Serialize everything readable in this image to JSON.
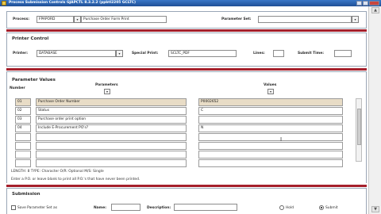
{
  "window": {
    "title": "Process Submission Controls GJAPCTL 8.3.2.2 (ppbtl2205 GCLTC)"
  },
  "header": {
    "process_label": "Process:",
    "process_code": "FPAPORD",
    "process_name": "Purchase Order Form Print",
    "parameter_set_label": "Parameter Set:",
    "parameter_set_value": ""
  },
  "printer_control": {
    "title": "Printer Control",
    "printer_label": "Printer:",
    "printer_value": "DATABASE",
    "special_print_label": "Special Print:",
    "special_print_value": "SCLTC_PDF",
    "lines_label": "Lines:",
    "lines_value": "",
    "submit_time_label": "Submit Time:",
    "submit_time_value": ""
  },
  "parameter_values": {
    "title": "Parameter Values",
    "col_number": "Number",
    "col_parameters": "Parameters",
    "col_values": "Values",
    "rows": [
      {
        "number": "01",
        "parameter": "Purchase Order Number",
        "value": "P0002652"
      },
      {
        "number": "02",
        "parameter": "Status",
        "value": "C"
      },
      {
        "number": "03",
        "parameter": "Purchase order print option",
        "value": ""
      },
      {
        "number": "04",
        "parameter": "Include E-Procurement PO's?",
        "value": "N"
      },
      {
        "number": "",
        "parameter": "",
        "value": ""
      },
      {
        "number": "",
        "parameter": "",
        "value": ""
      },
      {
        "number": "",
        "parameter": "",
        "value": ""
      },
      {
        "number": "",
        "parameter": "",
        "value": ""
      }
    ],
    "length_info": "LENGTH: 8 TYPE: Character O/R: Optional M/S: Single",
    "help_text": "Enter a P.O. or leave blank to print all P.O.'s that have never been printed."
  },
  "submission": {
    "title": "Submission",
    "save_param_label": "Save Parameter Set as",
    "name_label": "Name:",
    "name_value": "",
    "description_label": "Description:",
    "description_value": "",
    "hold_label": "Hold",
    "submit_label": "Submit",
    "selected": "submit"
  },
  "colors": {
    "accent_bar": "#a51f2b",
    "title_bar": "#2a5ea8",
    "highlight_row": "#e8dcc6"
  },
  "icons": [
    "window-icon",
    "minimize-icon",
    "maximize-icon",
    "close-icon",
    "dropdown-arrow-icon",
    "text-cursor-icon"
  ]
}
